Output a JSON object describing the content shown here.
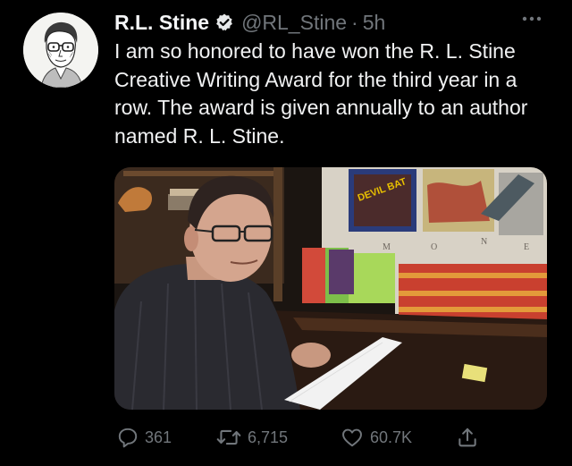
{
  "tweet": {
    "author_name": "R.L. Stine",
    "verified_icon": "verified-badge-icon",
    "handle": "@RL_Stine",
    "separator": "·",
    "time": "5h",
    "more_icon": "more-options-icon",
    "text": "I am so honored to have won the R. L. Stine Creative Writing Award for the third year in a row. The award is given annually to an author named R. L. Stine.",
    "media": {
      "description_icon": "photo-author-reading-at-desk",
      "poster_text": "DEVIL BAT"
    },
    "actions": {
      "reply": {
        "icon": "reply-icon",
        "count": "361"
      },
      "retweet": {
        "icon": "retweet-icon",
        "count": "6,715"
      },
      "like": {
        "icon": "heart-icon",
        "count": "60.7K"
      },
      "share": {
        "icon": "share-icon"
      }
    }
  },
  "colors": {
    "background": "#000000",
    "text_primary": "#e7e9ea",
    "text_secondary": "#71767b",
    "verified": "#e7e9ea"
  }
}
